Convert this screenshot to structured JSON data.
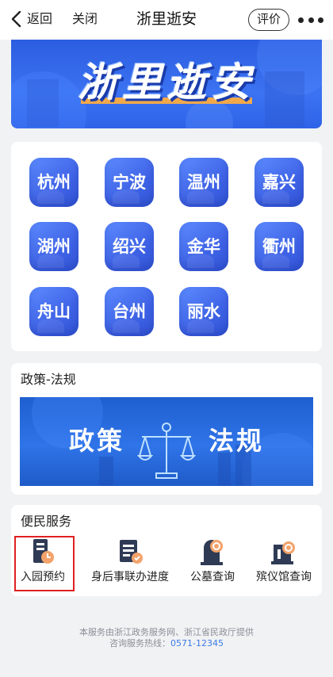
{
  "nav": {
    "back_label": "返回",
    "close_label": "关闭",
    "title": "浙里逝安",
    "rate_label": "评价"
  },
  "banner": {
    "title": "浙里逝安"
  },
  "cities": [
    "杭州",
    "宁波",
    "温州",
    "嘉兴",
    "湖州",
    "绍兴",
    "金华",
    "衢州",
    "舟山",
    "台州",
    "丽水"
  ],
  "policy": {
    "section_title": "政策-法规",
    "banner_left": "政策",
    "banner_right": "法规"
  },
  "services": {
    "section_title": "便民服务",
    "items": [
      {
        "label": "入园预约",
        "icon": "park-reservation-icon"
      },
      {
        "label": "身后事联办进度",
        "icon": "after-death-progress-icon"
      },
      {
        "label": "公墓查询",
        "icon": "cemetery-search-icon"
      },
      {
        "label": "殡仪馆查询",
        "icon": "funeral-home-search-icon"
      }
    ]
  },
  "footer": {
    "line1": "本服务由浙江政务服务网、浙江省民政厅提供",
    "hotline_label": "咨询服务热线：",
    "hotline_number": "0571-12345"
  },
  "colors": {
    "accent_blue": "#3f63e6",
    "highlight_red": "#e02020",
    "banner_stripe": "#f1a94a"
  }
}
